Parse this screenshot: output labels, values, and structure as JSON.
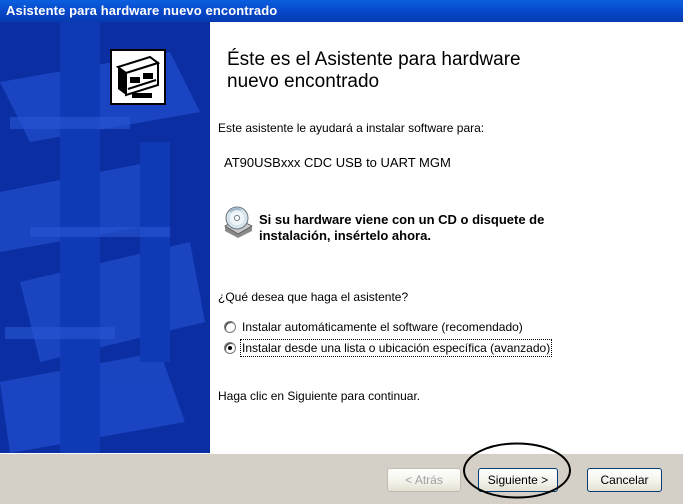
{
  "window": {
    "title": "Asistente para hardware nuevo encontrado"
  },
  "content": {
    "heading": "Éste es el Asistente para hardware\nnuevo encontrado",
    "intro": "Este asistente le ayudará a instalar software para:",
    "device": "AT90USBxxx CDC USB to UART MGM",
    "cd_note": "Si su hardware viene con un CD o disquete de\ninstalación, insértelo ahora.",
    "question": "¿Qué desea que haga el asistente?",
    "options": [
      {
        "label": "Instalar automáticamente el software (recomendado)",
        "selected": false
      },
      {
        "label": "Instalar desde una lista o ubicación específica (avanzado)",
        "selected": true
      }
    ],
    "continue_text": "Haga clic en Siguiente para continuar."
  },
  "buttons": {
    "back": "< Atrás",
    "next": "Siguiente >",
    "cancel": "Cancelar"
  },
  "icons": {
    "wizard": "hardware-card-icon",
    "cd": "cd-disk-icon"
  },
  "colors": {
    "title_bar": "#0746c8",
    "sidebar": "#0b2fa3",
    "button_face": "#ece9d8"
  }
}
